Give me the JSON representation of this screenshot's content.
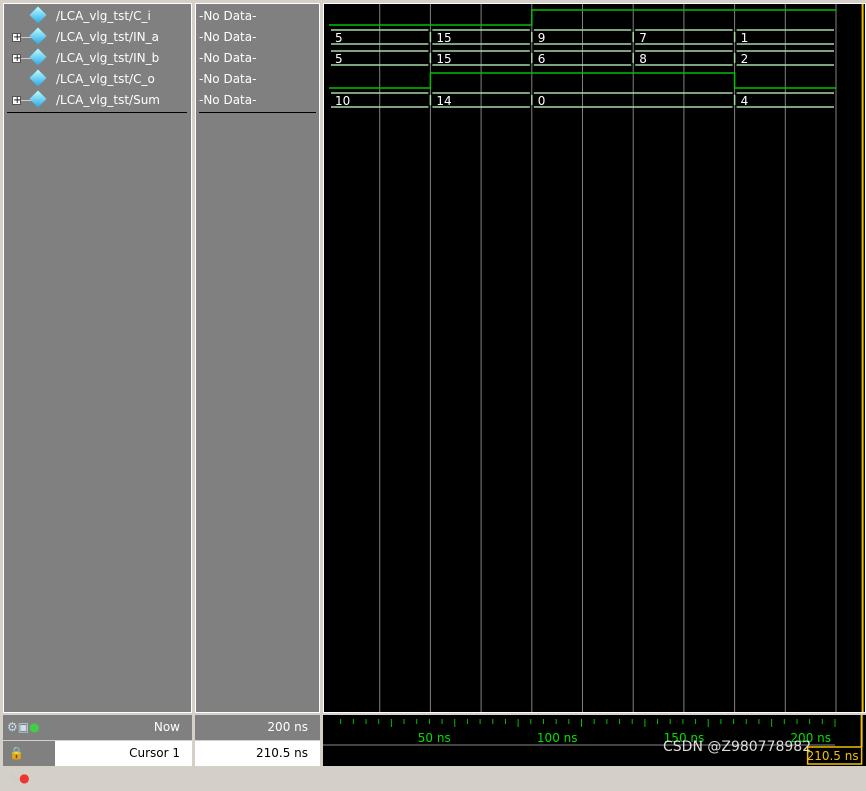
{
  "signals": [
    {
      "name": "/LCA_vlg_tst/C_i",
      "value": "-No Data-",
      "expandable": false,
      "type": "bit",
      "wave": [
        [
          0,
          0
        ],
        [
          80,
          1
        ]
      ]
    },
    {
      "name": "/LCA_vlg_tst/IN_a",
      "value": "-No Data-",
      "expandable": true,
      "type": "bus",
      "wave": [
        [
          0,
          "5"
        ],
        [
          40,
          "15"
        ],
        [
          80,
          "9"
        ],
        [
          120,
          "7"
        ],
        [
          160,
          "1"
        ]
      ]
    },
    {
      "name": "/LCA_vlg_tst/IN_b",
      "value": "-No Data-",
      "expandable": true,
      "type": "bus",
      "wave": [
        [
          0,
          "5"
        ],
        [
          40,
          "15"
        ],
        [
          80,
          "6"
        ],
        [
          120,
          "8"
        ],
        [
          160,
          "2"
        ]
      ]
    },
    {
      "name": "/LCA_vlg_tst/C_o",
      "value": "-No Data-",
      "expandable": false,
      "type": "bit",
      "wave": [
        [
          0,
          0
        ],
        [
          40,
          1
        ],
        [
          160,
          0
        ]
      ]
    },
    {
      "name": "/LCA_vlg_tst/Sum",
      "value": "-No Data-",
      "expandable": true,
      "type": "bus",
      "wave": [
        [
          0,
          "10"
        ],
        [
          40,
          "14"
        ],
        [
          80,
          "0"
        ],
        [
          160,
          "4"
        ]
      ]
    }
  ],
  "time_range_ns": [
    0,
    200
  ],
  "ticks": [
    {
      "t": 50,
      "label": "50 ns"
    },
    {
      "t": 100,
      "label": "100 ns"
    },
    {
      "t": 150,
      "label": "150 ns"
    },
    {
      "t": 200,
      "label": "200 ns"
    }
  ],
  "now": {
    "label": "Now",
    "value": "200 ns"
  },
  "cursor": {
    "label": "Cursor 1",
    "value": "210.5 ns",
    "time_ns": 210.5,
    "readout": "210.5 ns"
  },
  "watermark": "CSDN @Z980778982",
  "colors": {
    "bit": "#00c000",
    "bus": "#a8d8a8",
    "cursor": "#f0c000",
    "grid": "#808080"
  }
}
